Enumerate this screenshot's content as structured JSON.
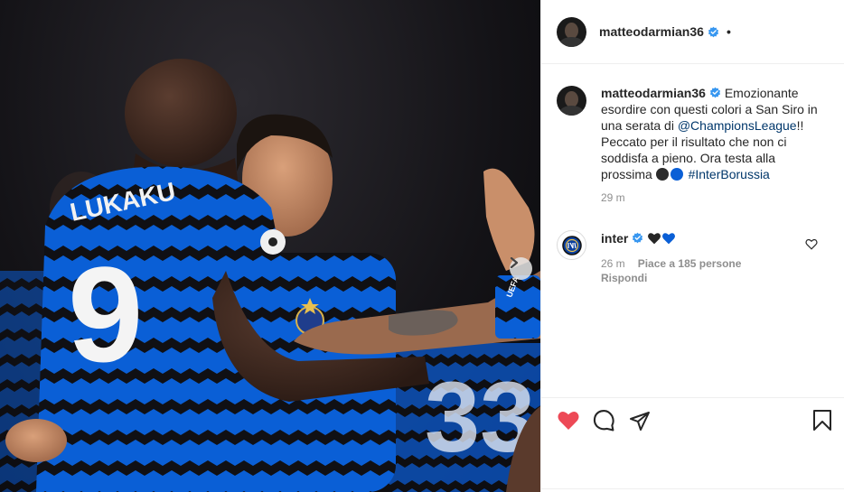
{
  "post": {
    "author": "matteodarmian36",
    "verified": true,
    "separator": "•"
  },
  "photo": {
    "jersey_name": "LUKAKU",
    "jersey_number": "9",
    "background_number": "33",
    "sleeve_badge": "UEFA"
  },
  "caption": {
    "username": "matteodarmian36",
    "text_before_mention": "Emozionante esordire con questi colori a San Siro in una serata di ",
    "mention": "@ChampionsLeague",
    "text_after_mention": "!! Peccato per il risultato che non ci soddisfa a pieno. Ora testa alla prossima ",
    "hashtag": "#InterBorussia",
    "time": "29 m"
  },
  "comment": {
    "username": "inter",
    "verified": true,
    "time": "26 m",
    "likes": "Piace a 185 persone",
    "reply": "Rispondi"
  },
  "colors": {
    "inter_blue": "#0a5fd6",
    "inter_black": "#111111",
    "verified_blue": "#3897f0",
    "like_red": "#ed4956",
    "link": "#00376b"
  },
  "icons": {
    "verified": "verified-badge-icon",
    "next": "chevron-right-icon",
    "like": "heart-filled-icon",
    "comment": "speech-bubble-icon",
    "share": "paper-plane-icon",
    "save": "bookmark-icon",
    "comment_like": "heart-outline-icon"
  }
}
